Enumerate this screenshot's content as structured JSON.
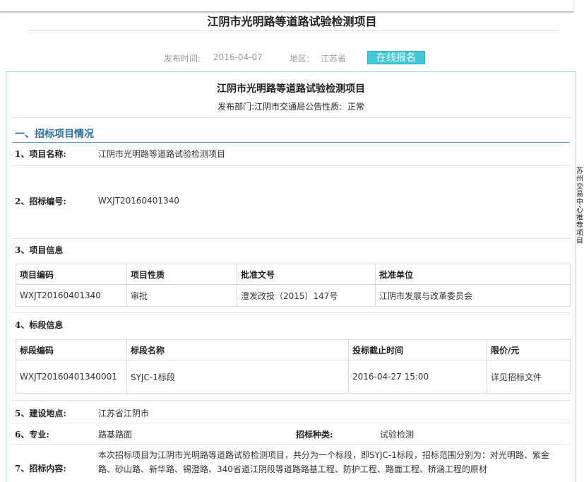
{
  "page": {
    "title": "江阴市光明路等道路试验检测项目"
  },
  "meta": {
    "publish_label": "发布时间:",
    "publish_date": "2016-04-07",
    "region_label": "地区:",
    "region": "江苏省",
    "signup_button": "在线报名"
  },
  "notice": {
    "title": "江阴市光明路等道路试验检测项目",
    "department_label": "发布部门:",
    "department": "江阴市交通局",
    "nature_label": "公告性质:",
    "nature": "正常"
  },
  "section1": {
    "heading": "一、招标项目情况"
  },
  "fields": {
    "project_name_label": "1、项目名称:",
    "project_name": "江阴市光明路等道路试验检测项目",
    "tender_no_label": "2、招标编号:",
    "tender_no": "WXJT20160401340",
    "project_info_label": "3、项目信息",
    "lot_info_label": "4、标段信息",
    "location_label": "5、建设地点:",
    "location": "江苏省江阴市",
    "specialty_label": "6、专业:",
    "specialty": "路基路面",
    "tender_type_label": "招标种类:",
    "tender_type": "试验检测",
    "scope_label": "7、招标内容:",
    "scope_text": "本次招标项目为江阴市光明路等道路试验检测项目，共分为一个标段，即SYJC-1标段，招标范围分别为：对光明路、紫金路、砂山路、新华路、锡澄路、340省道江阴段等道路路基工程、防护工程、路面工程、桥涵工程的原材"
  },
  "project_table": {
    "headers": [
      "项目编码",
      "项目性质",
      "批准文号",
      "批准单位"
    ],
    "rows": [
      [
        "WXJT20160401340",
        "审批",
        "澄发改投（2015）147号",
        "江阴市发展与改革委员会"
      ]
    ]
  },
  "lot_table": {
    "headers": [
      "标段编码",
      "标段名称",
      "投标截止时间",
      "限价/元"
    ],
    "rows": [
      [
        "WXJT20160401340001",
        "SYJC-1标段",
        "2016-04-27 15:00",
        "详见招标文件"
      ]
    ]
  },
  "side_tab": {
    "text": "苏州交易中心推荐项目"
  }
}
